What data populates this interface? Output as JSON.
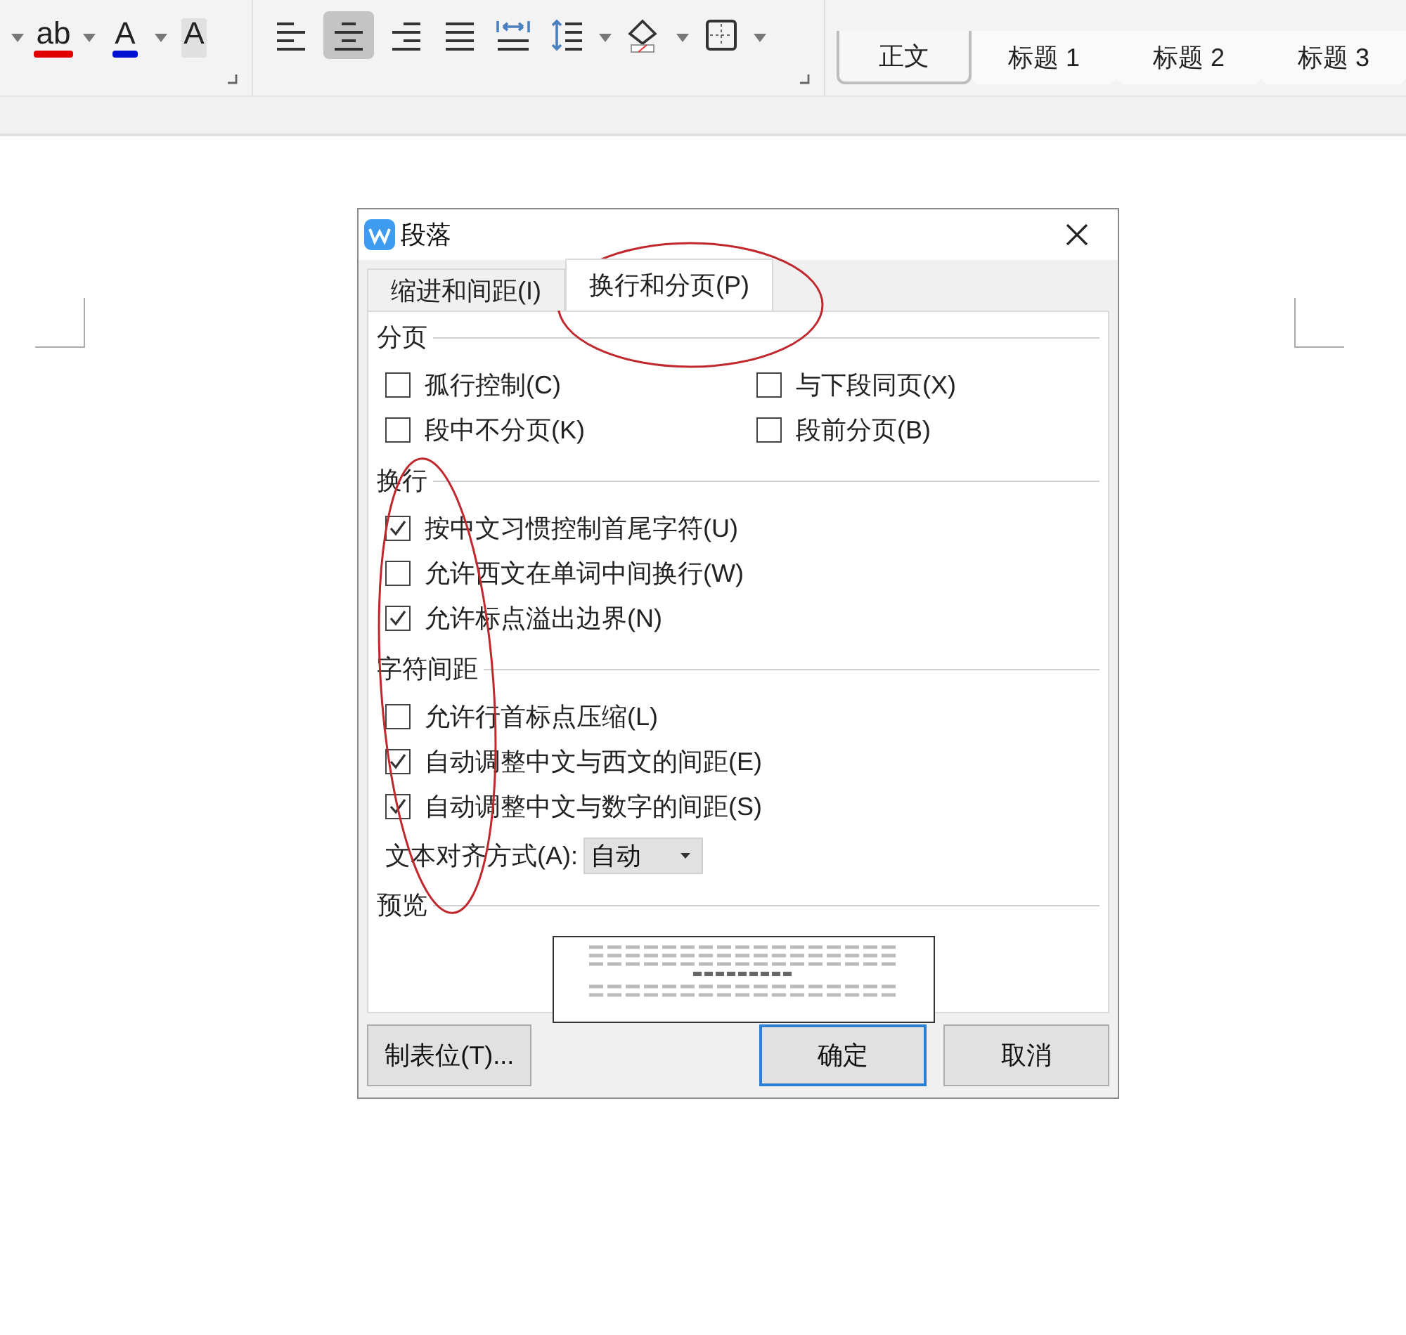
{
  "toolbar": {
    "font_buttons": [
      {
        "glyph": "ab",
        "kind": "underline",
        "color": "#e00000"
      },
      {
        "glyph": "A",
        "kind": "underline",
        "color": "#0010d0"
      },
      {
        "glyph": "A",
        "kind": "shaded"
      }
    ],
    "paragraph_buttons": [
      {
        "kind": "align-left",
        "selected": false
      },
      {
        "kind": "align-center",
        "selected": true
      },
      {
        "kind": "align-right",
        "selected": false
      },
      {
        "kind": "justify",
        "selected": false
      },
      {
        "kind": "distribute",
        "selected": false
      },
      {
        "kind": "line-spacing",
        "selected": false
      },
      {
        "kind": "shading",
        "selected": false
      },
      {
        "kind": "borders",
        "selected": false
      }
    ],
    "styles": [
      {
        "label": "正文",
        "selected": true
      },
      {
        "label": "标题 1",
        "selected": false
      },
      {
        "label": "标题 2",
        "selected": false
      },
      {
        "label": "标题 3",
        "selected": false
      }
    ]
  },
  "dialog": {
    "title": "段落",
    "tabs": [
      {
        "label": "缩进和间距(I)",
        "selected": false
      },
      {
        "label": "换行和分页(P)",
        "selected": true
      }
    ],
    "sections": [
      {
        "title": "分页",
        "kind": "grid",
        "options": [
          {
            "label": "孤行控制(C)",
            "checked": false
          },
          {
            "label": "与下段同页(X)",
            "checked": false
          },
          {
            "label": "段中不分页(K)",
            "checked": false
          },
          {
            "label": "段前分页(B)",
            "checked": false
          }
        ]
      },
      {
        "title": "换行",
        "kind": "list",
        "options": [
          {
            "label": "按中文习惯控制首尾字符(U)",
            "checked": true
          },
          {
            "label": "允许西文在单词中间换行(W)",
            "checked": false
          },
          {
            "label": "允许标点溢出边界(N)",
            "checked": true
          }
        ]
      },
      {
        "title": "字符间距",
        "kind": "list",
        "options": [
          {
            "label": "允许行首标点压缩(L)",
            "checked": false
          },
          {
            "label": "自动调整中文与西文的间距(E)",
            "checked": true
          },
          {
            "label": "自动调整中文与数字的间距(S)",
            "checked": true
          }
        ]
      }
    ],
    "align": {
      "label": "文本对齐方式(A):",
      "value": "自动"
    },
    "preview_title": "预览",
    "buttons": [
      {
        "label": "制表位(T)...",
        "kind": "left"
      },
      {
        "label": "确定",
        "kind": "default"
      },
      {
        "label": "取消",
        "kind": "normal"
      }
    ]
  }
}
